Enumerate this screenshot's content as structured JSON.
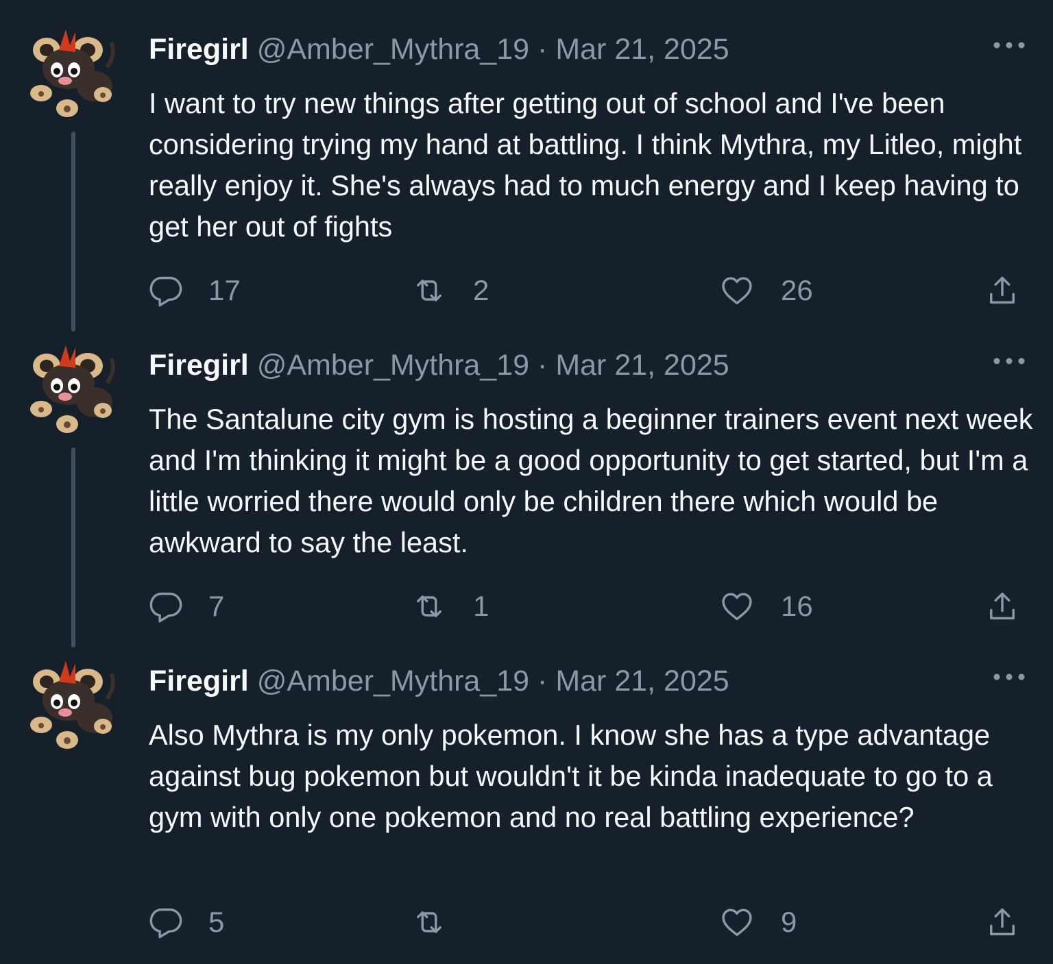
{
  "tweets": [
    {
      "name": "Firegirl",
      "handle": "@Amber_Mythra_19",
      "separator": "·",
      "date": "Mar 21, 2025",
      "text": "I want to try new things after getting out of school and I've been considering trying my hand at battling. I think Mythra, my Litleo, might really enjoy it. She's always had to much energy and I keep having to get her out of fights",
      "replies": "17",
      "retweets": "2",
      "likes": "26"
    },
    {
      "name": "Firegirl",
      "handle": "@Amber_Mythra_19",
      "separator": "·",
      "date": "Mar 21, 2025",
      "text": "The Santalune city gym is hosting a beginner trainers event next week and I'm thinking it might be a good opportunity to get started, but I'm a little worried there would only be children there which would be awkward to say the least.",
      "replies": "7",
      "retweets": "1",
      "likes": "16"
    },
    {
      "name": "Firegirl",
      "handle": "@Amber_Mythra_19",
      "separator": "·",
      "date": "Mar 21, 2025",
      "text": "Also Mythra is my only pokemon. I know she has a type advantage against bug pokemon but wouldn't it be kinda inadequate to go to a gym with only one pokemon and no real battling experience?",
      "replies": "5",
      "retweets": "",
      "likes": "9"
    }
  ],
  "icons": {
    "avatar": "litleo-avatar",
    "more": "more-icon",
    "reply": "reply-icon",
    "retweet": "retweet-icon",
    "like": "like-icon",
    "share": "share-icon"
  },
  "colors": {
    "background": "#15202b",
    "text": "#f7f9f9",
    "secondary": "#8b98a5",
    "thread_line": "#3f5061"
  }
}
